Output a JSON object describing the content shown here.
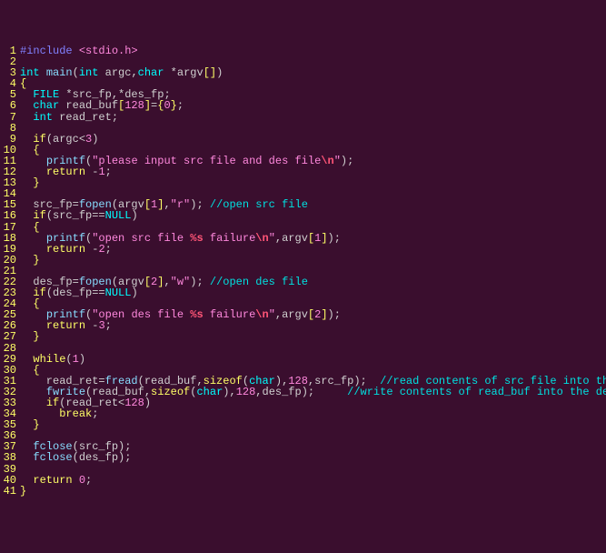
{
  "lines": [
    {
      "n": 1,
      "seg": [
        [
          "#include ",
          "pp"
        ],
        [
          "<stdio.h>",
          "ang"
        ]
      ]
    },
    {
      "n": 2,
      "seg": []
    },
    {
      "n": 3,
      "seg": [
        [
          "int",
          "ty"
        ],
        [
          " ",
          "id"
        ],
        [
          "main",
          "fn"
        ],
        [
          "(",
          "id"
        ],
        [
          "int",
          "ty"
        ],
        [
          " argc,",
          "id"
        ],
        [
          "char",
          "ty"
        ],
        [
          " *argv",
          "id"
        ],
        [
          "[]",
          "pu"
        ],
        [
          ")",
          "id"
        ]
      ]
    },
    {
      "n": 4,
      "seg": [
        [
          "{",
          "pu"
        ]
      ]
    },
    {
      "n": 5,
      "seg": [
        [
          "  ",
          "id"
        ],
        [
          "FILE",
          "ty"
        ],
        [
          " *src_fp,*des_fp;",
          "id"
        ]
      ]
    },
    {
      "n": 6,
      "seg": [
        [
          "  ",
          "id"
        ],
        [
          "char",
          "ty"
        ],
        [
          " read_buf",
          "id"
        ],
        [
          "[",
          "pu"
        ],
        [
          "128",
          "num"
        ],
        [
          "]",
          "pu"
        ],
        [
          "=",
          "id"
        ],
        [
          "{",
          "pu"
        ],
        [
          "0",
          "num"
        ],
        [
          "}",
          "pu"
        ],
        [
          ";",
          "id"
        ]
      ]
    },
    {
      "n": 7,
      "seg": [
        [
          "  ",
          "id"
        ],
        [
          "int",
          "ty"
        ],
        [
          " read_ret;",
          "id"
        ]
      ]
    },
    {
      "n": 8,
      "seg": []
    },
    {
      "n": 9,
      "seg": [
        [
          "  ",
          "id"
        ],
        [
          "if",
          "kw"
        ],
        [
          "(argc<",
          "id"
        ],
        [
          "3",
          "num"
        ],
        [
          ")",
          "id"
        ]
      ]
    },
    {
      "n": 10,
      "seg": [
        [
          "  ",
          "id"
        ],
        [
          "{",
          "pu"
        ]
      ]
    },
    {
      "n": 11,
      "seg": [
        [
          "    ",
          "id"
        ],
        [
          "printf",
          "fn"
        ],
        [
          "(",
          "id"
        ],
        [
          "\"please input src file and des file",
          "str"
        ],
        [
          "\\n",
          "esc"
        ],
        [
          "\"",
          "str"
        ],
        [
          ");",
          "id"
        ]
      ]
    },
    {
      "n": 12,
      "seg": [
        [
          "    ",
          "id"
        ],
        [
          "return",
          "kw"
        ],
        [
          " -",
          "id"
        ],
        [
          "1",
          "num"
        ],
        [
          ";",
          "id"
        ]
      ]
    },
    {
      "n": 13,
      "seg": [
        [
          "  ",
          "id"
        ],
        [
          "}",
          "pu"
        ]
      ]
    },
    {
      "n": 14,
      "seg": []
    },
    {
      "n": 15,
      "seg": [
        [
          "  src_fp=",
          "id"
        ],
        [
          "fopen",
          "fn"
        ],
        [
          "(argv",
          "id"
        ],
        [
          "[",
          "pu"
        ],
        [
          "1",
          "num"
        ],
        [
          "]",
          "pu"
        ],
        [
          ",",
          "id"
        ],
        [
          "\"r\"",
          "str"
        ],
        [
          "); ",
          "id"
        ],
        [
          "//open src file",
          "cmt"
        ]
      ]
    },
    {
      "n": 16,
      "seg": [
        [
          "  ",
          "id"
        ],
        [
          "if",
          "kw"
        ],
        [
          "(src_fp==",
          "id"
        ],
        [
          "NULL",
          "ty"
        ],
        [
          ")",
          "id"
        ]
      ]
    },
    {
      "n": 17,
      "seg": [
        [
          "  ",
          "id"
        ],
        [
          "{",
          "pu"
        ]
      ]
    },
    {
      "n": 18,
      "seg": [
        [
          "    ",
          "id"
        ],
        [
          "printf",
          "fn"
        ],
        [
          "(",
          "id"
        ],
        [
          "\"open src file ",
          "str"
        ],
        [
          "%s",
          "esc"
        ],
        [
          " failure",
          "str"
        ],
        [
          "\\n",
          "esc"
        ],
        [
          "\"",
          "str"
        ],
        [
          ",argv",
          "id"
        ],
        [
          "[",
          "pu"
        ],
        [
          "1",
          "num"
        ],
        [
          "]",
          "pu"
        ],
        [
          ");",
          "id"
        ]
      ]
    },
    {
      "n": 19,
      "seg": [
        [
          "    ",
          "id"
        ],
        [
          "return",
          "kw"
        ],
        [
          " -",
          "id"
        ],
        [
          "2",
          "num"
        ],
        [
          ";",
          "id"
        ]
      ]
    },
    {
      "n": 20,
      "seg": [
        [
          "  ",
          "id"
        ],
        [
          "}",
          "pu"
        ]
      ]
    },
    {
      "n": 21,
      "seg": []
    },
    {
      "n": 22,
      "seg": [
        [
          "  des_fp=",
          "id"
        ],
        [
          "fopen",
          "fn"
        ],
        [
          "(argv",
          "id"
        ],
        [
          "[",
          "pu"
        ],
        [
          "2",
          "num"
        ],
        [
          "]",
          "pu"
        ],
        [
          ",",
          "id"
        ],
        [
          "\"w\"",
          "str"
        ],
        [
          "); ",
          "id"
        ],
        [
          "//open des file",
          "cmt"
        ]
      ]
    },
    {
      "n": 23,
      "seg": [
        [
          "  ",
          "id"
        ],
        [
          "if",
          "kw"
        ],
        [
          "(des_fp==",
          "id"
        ],
        [
          "NULL",
          "ty"
        ],
        [
          ")",
          "id"
        ]
      ]
    },
    {
      "n": 24,
      "seg": [
        [
          "  ",
          "id"
        ],
        [
          "{",
          "pu"
        ]
      ]
    },
    {
      "n": 25,
      "seg": [
        [
          "    ",
          "id"
        ],
        [
          "printf",
          "fn"
        ],
        [
          "(",
          "id"
        ],
        [
          "\"open des file ",
          "str"
        ],
        [
          "%s",
          "esc"
        ],
        [
          " failure",
          "str"
        ],
        [
          "\\n",
          "esc"
        ],
        [
          "\"",
          "str"
        ],
        [
          ",argv",
          "id"
        ],
        [
          "[",
          "pu"
        ],
        [
          "2",
          "num"
        ],
        [
          "]",
          "pu"
        ],
        [
          ");",
          "id"
        ]
      ]
    },
    {
      "n": 26,
      "seg": [
        [
          "    ",
          "id"
        ],
        [
          "return",
          "kw"
        ],
        [
          " -",
          "id"
        ],
        [
          "3",
          "num"
        ],
        [
          ";",
          "id"
        ]
      ]
    },
    {
      "n": 27,
      "seg": [
        [
          "  ",
          "id"
        ],
        [
          "}",
          "pu"
        ]
      ]
    },
    {
      "n": 28,
      "seg": []
    },
    {
      "n": 29,
      "seg": [
        [
          "  ",
          "id"
        ],
        [
          "while",
          "kw"
        ],
        [
          "(",
          "id"
        ],
        [
          "1",
          "num"
        ],
        [
          ")",
          "id"
        ]
      ]
    },
    {
      "n": 30,
      "seg": [
        [
          "  ",
          "id"
        ],
        [
          "{",
          "pu"
        ]
      ]
    },
    {
      "n": 31,
      "seg": [
        [
          "    read_ret=",
          "id"
        ],
        [
          "fread",
          "fn"
        ],
        [
          "(read_buf,",
          "id"
        ],
        [
          "sizeof",
          "kw"
        ],
        [
          "(",
          "id"
        ],
        [
          "char",
          "ty"
        ],
        [
          "),",
          "id"
        ],
        [
          "128",
          "num"
        ],
        [
          ",src_fp);  ",
          "id"
        ],
        [
          "//read contents of src file into the read_buf",
          "cmt"
        ]
      ]
    },
    {
      "n": 32,
      "seg": [
        [
          "    ",
          "id"
        ],
        [
          "fwrite",
          "fn"
        ],
        [
          "(read_buf,",
          "id"
        ],
        [
          "sizeof",
          "kw"
        ],
        [
          "(",
          "id"
        ],
        [
          "char",
          "ty"
        ],
        [
          "),",
          "id"
        ],
        [
          "128",
          "num"
        ],
        [
          ",des_fp);     ",
          "id"
        ],
        [
          "//write contents of read_buf into the des file",
          "cmt"
        ]
      ]
    },
    {
      "n": 33,
      "seg": [
        [
          "    ",
          "id"
        ],
        [
          "if",
          "kw"
        ],
        [
          "(read_ret<",
          "id"
        ],
        [
          "128",
          "num"
        ],
        [
          ")",
          "id"
        ]
      ]
    },
    {
      "n": 34,
      "seg": [
        [
          "      ",
          "id"
        ],
        [
          "break",
          "kw"
        ],
        [
          ";",
          "id"
        ]
      ]
    },
    {
      "n": 35,
      "seg": [
        [
          "  ",
          "id"
        ],
        [
          "}",
          "pu"
        ]
      ]
    },
    {
      "n": 36,
      "seg": []
    },
    {
      "n": 37,
      "seg": [
        [
          "  ",
          "id"
        ],
        [
          "fclose",
          "fn"
        ],
        [
          "(src_fp);",
          "id"
        ]
      ]
    },
    {
      "n": 38,
      "seg": [
        [
          "  ",
          "id"
        ],
        [
          "fclose",
          "fn"
        ],
        [
          "(des_fp);",
          "id"
        ]
      ]
    },
    {
      "n": 39,
      "seg": []
    },
    {
      "n": 40,
      "seg": [
        [
          "  ",
          "id"
        ],
        [
          "return",
          "kw"
        ],
        [
          " ",
          "id"
        ],
        [
          "0",
          "num"
        ],
        [
          ";",
          "id"
        ]
      ]
    },
    {
      "n": 41,
      "seg": [
        [
          "}",
          "pu"
        ]
      ]
    }
  ]
}
